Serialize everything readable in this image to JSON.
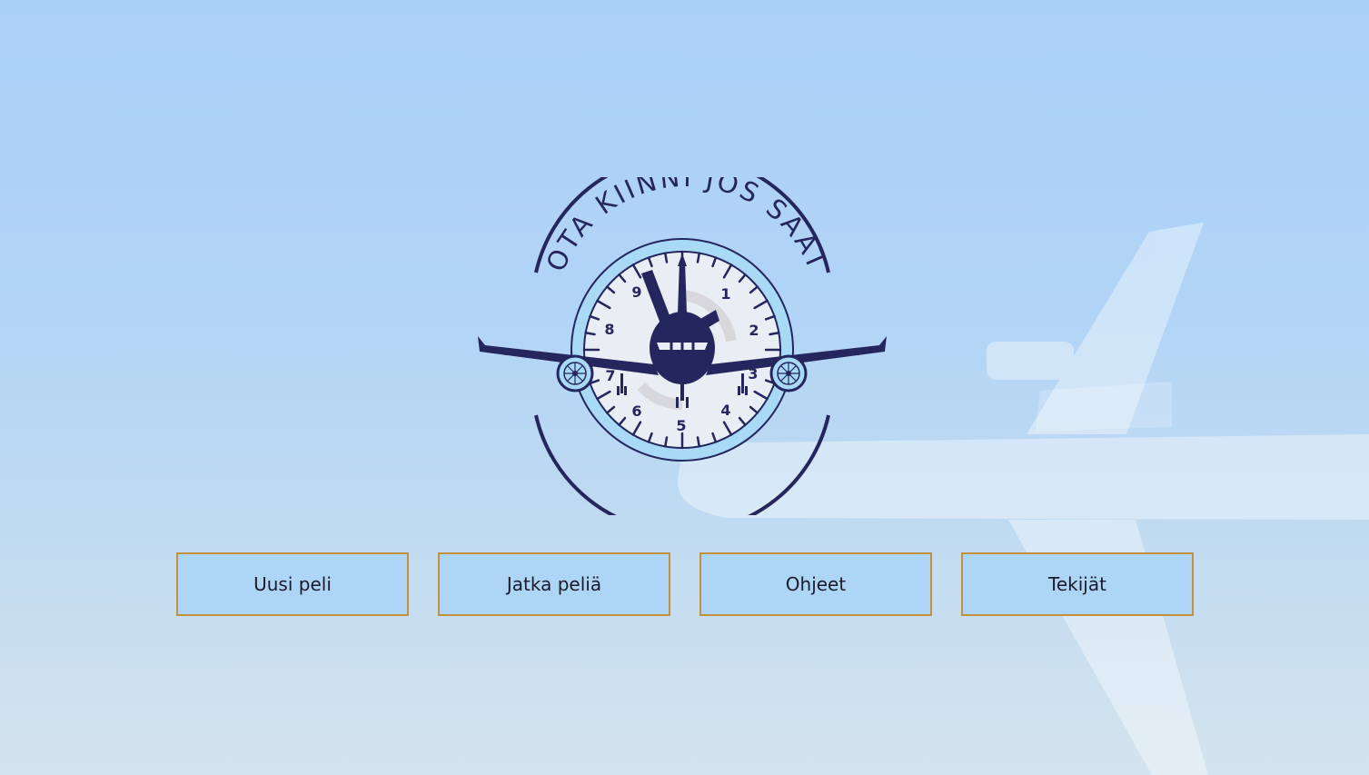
{
  "background": {
    "description_icon": "airplane-silhouette",
    "sky_top_color": "#abd0f8",
    "sky_bottom_color": "#d4e4ee"
  },
  "logo": {
    "title": "OTA KIINNI JOS SAAT",
    "icon": "airplane-clock-emblem",
    "clock_numbers": [
      "1",
      "2",
      "3",
      "4",
      "5",
      "6",
      "7",
      "8",
      "9"
    ],
    "primary_color": "#25265e",
    "ring_color": "#a8daf6"
  },
  "menu": {
    "buttons": [
      {
        "label": "Uusi peli"
      },
      {
        "label": "Jatka peliä"
      },
      {
        "label": "Ohjeet"
      },
      {
        "label": "Tekijät"
      }
    ],
    "button_color": "#add5f6",
    "border_color": "#c4913a"
  }
}
